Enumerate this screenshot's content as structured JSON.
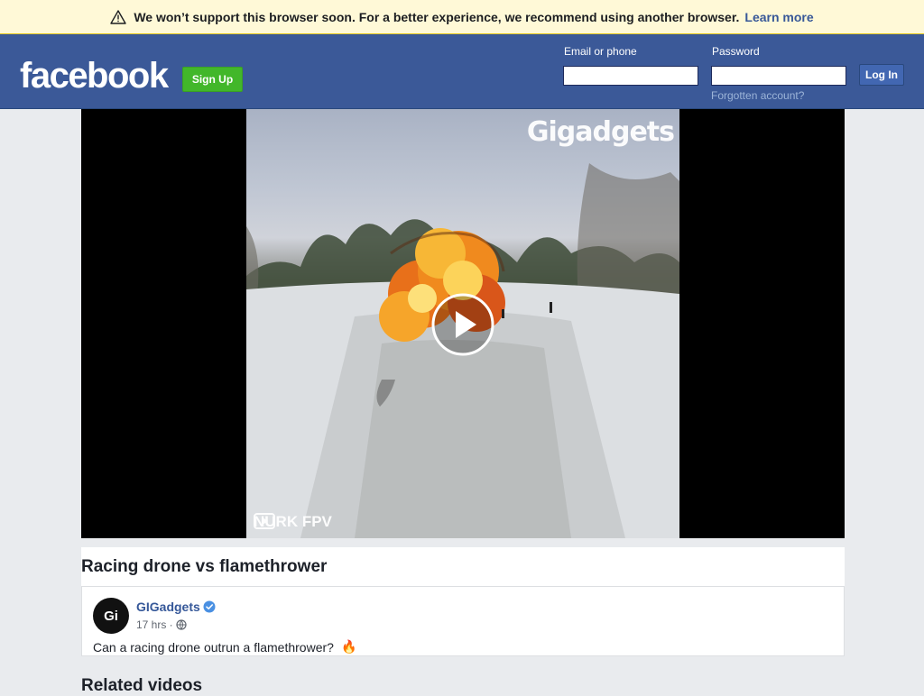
{
  "banner": {
    "message": "We won’t support this browser soon. For a better experience, we recommend using another browser.",
    "link": "Learn more",
    "icon": "warning-icon"
  },
  "header": {
    "logo": "facebook",
    "signup_label": "Sign Up",
    "email_label": "Email or phone",
    "email_value": "",
    "password_label": "Password",
    "password_value": "",
    "login_label": "Log In",
    "forgot_label": "Forgotten account?",
    "colors": {
      "bar": "#3b5998",
      "signup": "#42b72a",
      "login": "#4267b2"
    }
  },
  "video": {
    "watermark": "Gigadgets",
    "channel_mark": "NURK FPV",
    "play_icon": "play-icon"
  },
  "post": {
    "title": "Racing drone vs flamethrower",
    "page_name": "GIGadgets",
    "avatar_text": "Gi",
    "time": "17 hrs ·",
    "privacy_icon": "globe-icon",
    "verified_icon": "verified-badge-icon",
    "caption": "Can a racing drone outrun a flamethrower?",
    "caption_emoji": "🔥"
  },
  "related_heading": "Related videos"
}
